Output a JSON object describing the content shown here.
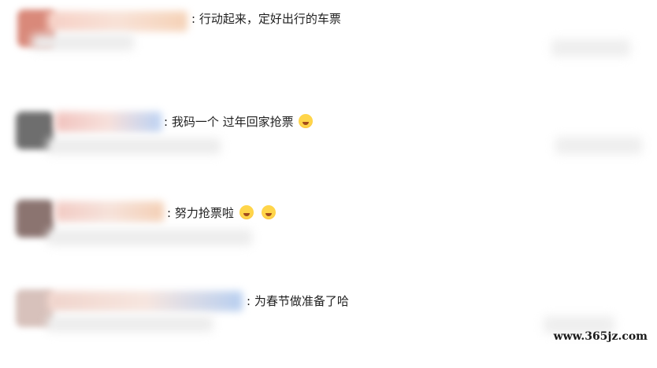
{
  "comments": [
    {
      "prefix": ":",
      "text": "行动起来，定好出行的车票",
      "emoji_count": 0,
      "avatar_color": "#d9897a",
      "name_color": "#f3c9b5"
    },
    {
      "prefix": ":",
      "text": "我码一个 过年回家抢票",
      "emoji_count": 1,
      "avatar_color": "#6e6e6e",
      "name_color": "#f2c7c2"
    },
    {
      "prefix": ":",
      "text": "努力抢票啦",
      "emoji_count": 2,
      "avatar_color": "#8b7470",
      "name_color": "#f4cfc4"
    },
    {
      "prefix": ":",
      "text": "为春节做准备了哈",
      "emoji_count": 0,
      "avatar_color": "#d7c1bb",
      "name_color": "#f1d6cd"
    }
  ],
  "watermark": "www.365jz.com",
  "emoji_icon": "crying-face-icon"
}
